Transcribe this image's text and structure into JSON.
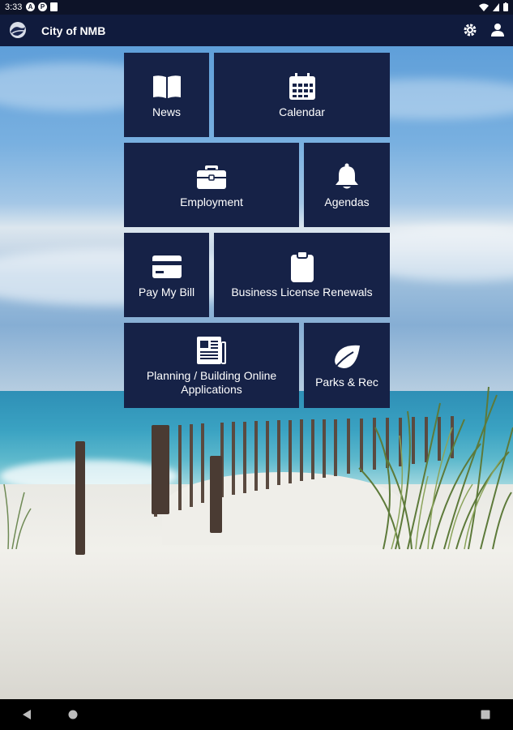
{
  "status_bar": {
    "time": "3:33"
  },
  "app_bar": {
    "title": "City of NMB",
    "logo_icon": "city-logo-icon",
    "settings_icon": "gear-icon",
    "account_icon": "user-icon"
  },
  "tiles": [
    {
      "label": "News",
      "icon": "book-icon"
    },
    {
      "label": "Calendar",
      "icon": "calendar-icon"
    },
    {
      "label": "Employment",
      "icon": "briefcase-icon"
    },
    {
      "label": "Agendas",
      "icon": "bell-icon"
    },
    {
      "label": "Pay My Bill",
      "icon": "credit-card-icon"
    },
    {
      "label": "Business License Renewals",
      "icon": "clipboard-icon"
    },
    {
      "label": "Planning / Building Online Applications",
      "icon": "newspaper-icon"
    },
    {
      "label": "Parks & Rec",
      "icon": "leaf-icon"
    }
  ],
  "colors": {
    "tile_bg": "#162247",
    "app_bar_bg": "#101b3d",
    "status_bar_bg": "#0d1328"
  },
  "nav_bar": {
    "back_icon": "back-triangle-icon",
    "home_icon": "home-circle-icon",
    "recents_icon": "recents-square-icon"
  }
}
